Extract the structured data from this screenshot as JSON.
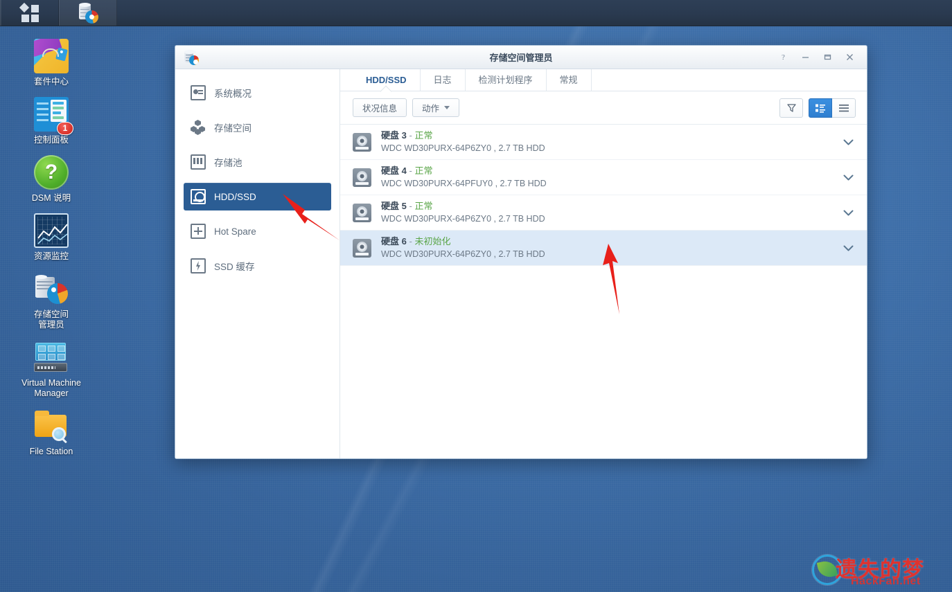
{
  "taskbar": {
    "main_menu_label": "main-menu",
    "apps": [
      {
        "name": "storage-manager",
        "title": "存储空间管理员"
      }
    ]
  },
  "desktop": {
    "icons": [
      {
        "id": "package-center",
        "label": "套件中心",
        "badge": null
      },
      {
        "id": "control-panel",
        "label": "控制面板",
        "badge": "1"
      },
      {
        "id": "dsm-help",
        "label": "DSM 说明",
        "badge": null
      },
      {
        "id": "resource-monitor",
        "label": "资源监控",
        "badge": null
      },
      {
        "id": "storage-manager",
        "label": "存储空间\n管理员",
        "label_line1": "存储空间",
        "label_line2": "管理员",
        "badge": null
      },
      {
        "id": "virtual-machine-manager",
        "label_line1": "Virtual Machine",
        "label_line2": "Manager",
        "label": "Virtual Machine Manager",
        "badge": null
      },
      {
        "id": "file-station",
        "label": "File Station",
        "badge": null
      }
    ]
  },
  "window": {
    "title": "存储空间管理员",
    "controls": {
      "help": "?",
      "minimize": "—",
      "maximize": "□",
      "close": "✕"
    },
    "sidebar": {
      "items": [
        {
          "id": "overview",
          "label": "系统概况",
          "icon": "overview-icon",
          "active": false
        },
        {
          "id": "volume",
          "label": "存储空间",
          "icon": "volume-icon",
          "active": false
        },
        {
          "id": "pool",
          "label": "存储池",
          "icon": "pool-icon",
          "active": false
        },
        {
          "id": "hdd-ssd",
          "label": "HDD/SSD",
          "icon": "hdd-icon",
          "active": true
        },
        {
          "id": "hot-spare",
          "label": "Hot Spare",
          "icon": "spare-icon",
          "active": false
        },
        {
          "id": "ssd-cache",
          "label": "SSD 缓存",
          "icon": "ssd-icon",
          "active": false
        }
      ]
    },
    "tabs": [
      {
        "id": "hdd-ssd",
        "label": "HDD/SSD",
        "active": true
      },
      {
        "id": "log",
        "label": "日志",
        "active": false
      },
      {
        "id": "schedule",
        "label": "检测计划程序",
        "active": false
      },
      {
        "id": "general",
        "label": "常规",
        "active": false
      }
    ],
    "toolbar": {
      "health_info_label": "状况信息",
      "action_label": "动作",
      "filter_icon": "filter-icon",
      "view_detail_icon": "list-detail-view-icon",
      "view_list_icon": "list-view-icon"
    },
    "disks": [
      {
        "name": "硬盘 3",
        "separator": "-",
        "status": "正常",
        "status_color": "#5aa548",
        "model": "WDC WD30PURX-64P6ZY0 , 2.7 TB HDD",
        "selected": false
      },
      {
        "name": "硬盘 4",
        "separator": "-",
        "status": "正常",
        "status_color": "#5aa548",
        "model": "WDC WD30PURX-64PFUY0 , 2.7 TB HDD",
        "selected": false
      },
      {
        "name": "硬盘 5",
        "separator": "-",
        "status": "正常",
        "status_color": "#5aa548",
        "model": "WDC WD30PURX-64P6ZY0 , 2.7 TB HDD",
        "selected": false
      },
      {
        "name": "硬盘 6",
        "separator": "-",
        "status": "未初始化",
        "status_color": "#5aa548",
        "model": "WDC WD30PURX-64P6ZY0 , 2.7 TB HDD",
        "selected": true
      }
    ]
  },
  "annotations": {
    "color": "#e8201a",
    "arrows": [
      {
        "id": "arrow-to-hdd-ssd-nav",
        "points_to": "hdd-ssd sidebar item"
      },
      {
        "id": "arrow-to-disk-6-row",
        "points_to": "硬盘 6 row"
      }
    ]
  },
  "watermark": {
    "cn_text": "遗失的梦",
    "en_text": "HackFan.net",
    "color": "#e8312a"
  }
}
